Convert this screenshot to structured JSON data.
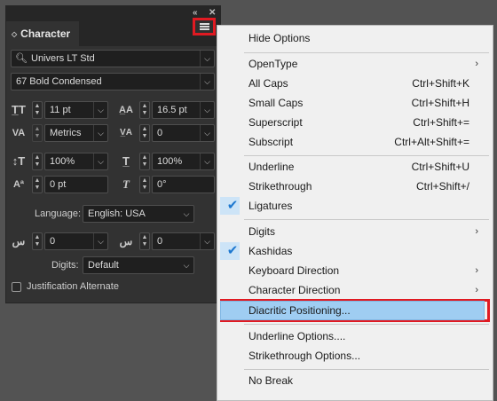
{
  "panel": {
    "title": "Character",
    "tab_arrows_icon": "up-down-arrows",
    "collapse_icon": "double-chevron-right",
    "close_icon": "close",
    "font_family": "Univers LT Std",
    "font_style": "67 Bold Condensed",
    "font_size": "11 pt",
    "leading": "16.5 pt",
    "kerning": "Metrics",
    "tracking": "0",
    "vertical_scale": "100%",
    "horizontal_scale": "100%",
    "baseline_shift": "0 pt",
    "skew": "0°",
    "language_label": "Language:",
    "language_value": "English: USA",
    "kashida_left": "0",
    "kashida_right": "0",
    "digits_label": "Digits:",
    "digits_value": "Default",
    "justification_label": "Justification Alternate"
  },
  "menu": {
    "items": [
      {
        "label": "Hide Options"
      },
      {
        "label": "OpenType",
        "submenu": "›"
      },
      {
        "label": "All Caps",
        "shortcut": "Ctrl+Shift+K"
      },
      {
        "label": "Small Caps",
        "shortcut": "Ctrl+Shift+H"
      },
      {
        "label": "Superscript",
        "shortcut": "Ctrl+Shift+="
      },
      {
        "label": "Subscript",
        "shortcut": "Ctrl+Alt+Shift+="
      },
      {
        "label": "Underline",
        "shortcut": "Ctrl+Shift+U"
      },
      {
        "label": "Strikethrough",
        "shortcut": "Ctrl+Shift+/"
      },
      {
        "label": "Ligatures",
        "checked": true
      },
      {
        "label": "Digits",
        "submenu": "›"
      },
      {
        "label": "Kashidas",
        "checked": true
      },
      {
        "label": "Keyboard Direction",
        "submenu": "›"
      },
      {
        "label": "Character Direction",
        "submenu": "›"
      },
      {
        "label": "Diacritic Positioning..."
      },
      {
        "label": "Underline Options...."
      },
      {
        "label": "Strikethrough Options..."
      },
      {
        "label": "No Break"
      }
    ],
    "check_glyph": "✔"
  },
  "colors": {
    "highlight_border": "#e01a22",
    "selection_fill": "#9fcdf2",
    "panel_bg": "#323232",
    "app_bg": "#535353"
  }
}
